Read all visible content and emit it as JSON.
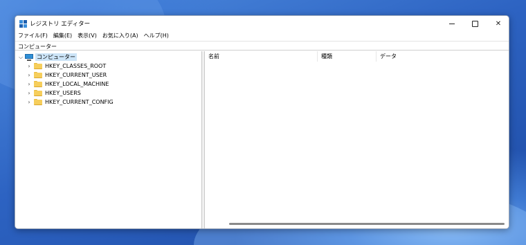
{
  "window": {
    "title": "レジストリ エディター"
  },
  "controls": {
    "minimize_icon": "minimize-icon",
    "maximize_icon": "maximize-icon",
    "close_icon": "close-icon",
    "close_glyph": "✕"
  },
  "menu": [
    "ファイル(F)",
    "編集(E)",
    "表示(V)",
    "お気に入り(A)",
    "ヘルプ(H)"
  ],
  "address": "コンピューター",
  "tree": {
    "root": {
      "label": "コンピューター",
      "expanded": true,
      "chevron": "⌵"
    },
    "keys": [
      {
        "label": "HKEY_CLASSES_ROOT",
        "chevron": "›"
      },
      {
        "label": "HKEY_CURRENT_USER",
        "chevron": "›"
      },
      {
        "label": "HKEY_LOCAL_MACHINE",
        "chevron": "›"
      },
      {
        "label": "HKEY_USERS",
        "chevron": "›"
      },
      {
        "label": "HKEY_CURRENT_CONFIG",
        "chevron": "›"
      }
    ]
  },
  "list": {
    "columns": [
      "名前",
      "種類",
      "データ"
    ]
  },
  "colors": {
    "selection": "#cce4f7",
    "folder": "#f6ce5c",
    "computer_icon": "#2f8fd6",
    "wallpaper": "#2d63c2"
  }
}
